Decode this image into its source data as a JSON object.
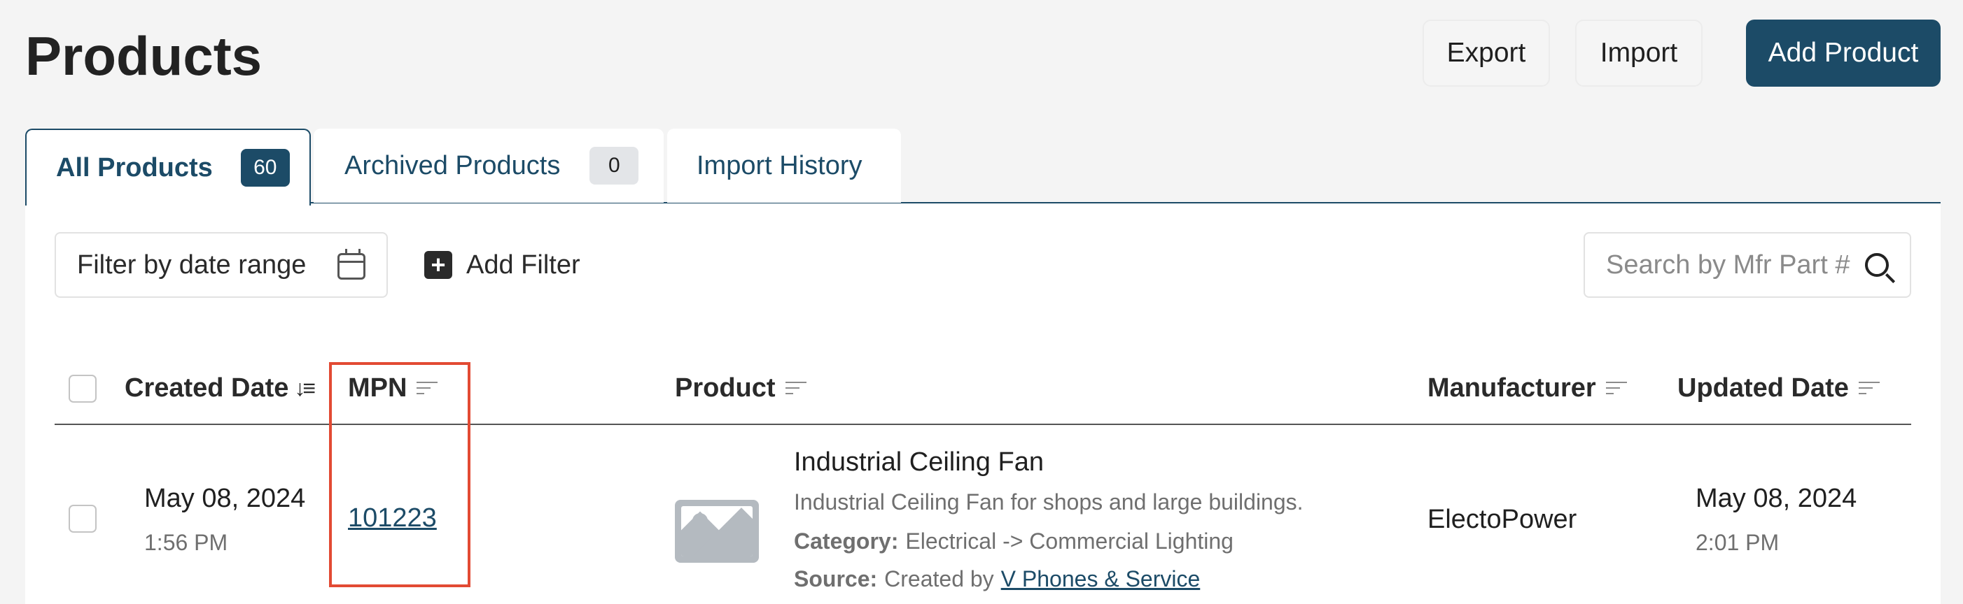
{
  "page": {
    "title": "Products"
  },
  "header_buttons": {
    "export": "Export",
    "import": "Import",
    "add_product": "Add Product"
  },
  "tabs": [
    {
      "label": "All Products",
      "count": "60",
      "active": true
    },
    {
      "label": "Archived Products",
      "count": "0",
      "active": false
    },
    {
      "label": "Import History",
      "active": false
    }
  ],
  "filters": {
    "date_range_label": "Filter by date range",
    "add_filter_label": "Add Filter",
    "search_placeholder": "Search by Mfr Part #"
  },
  "table": {
    "columns": {
      "created_date": "Created Date",
      "mpn": "MPN",
      "product": "Product",
      "manufacturer": "Manufacturer",
      "updated_date": "Updated Date"
    },
    "rows": [
      {
        "created_date": "May 08, 2024",
        "created_time": "1:56 PM",
        "mpn": "101223",
        "product_name": "Industrial Ceiling Fan",
        "product_description": "Industrial Ceiling Fan for shops and large buildings.",
        "category_label": "Category:",
        "category_value": "Electrical -> Commercial Lighting",
        "source_label": "Source:",
        "source_prefix": "Created by",
        "source_link": "V Phones & Service",
        "manufacturer": "ElectoPower",
        "updated_date": "May 08, 2024",
        "updated_time": "2:01 PM"
      }
    ]
  },
  "colors": {
    "brand": "#1c4b67",
    "highlight": "#e24a33",
    "background": "#f4f4f4"
  }
}
